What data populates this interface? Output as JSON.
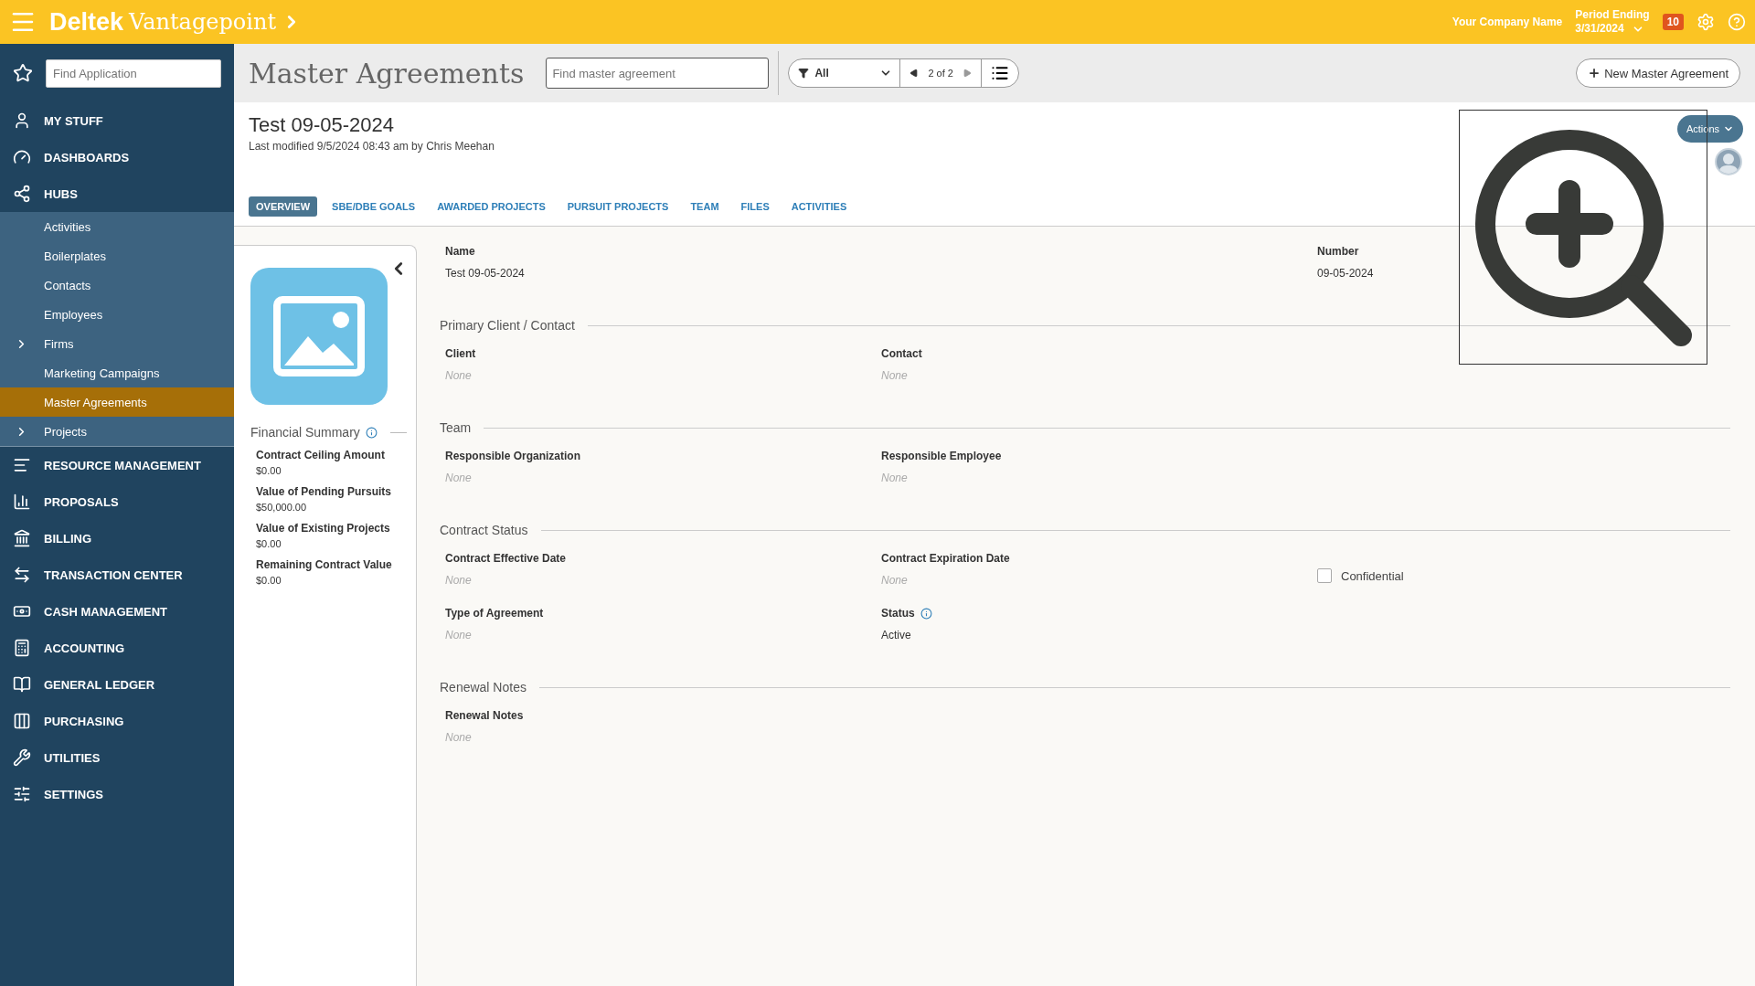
{
  "topbar": {
    "brand_name": "Deltek",
    "brand_product": "Vantagepoint",
    "company": "Your Company Name",
    "period_label": "Period Ending",
    "period_date": "3/31/2024",
    "notifications": "10"
  },
  "sidebar": {
    "search": {
      "placeholder": "Find Application"
    },
    "items": [
      {
        "label": "MY STUFF"
      },
      {
        "label": "DASHBOARDS"
      },
      {
        "label": "HUBS",
        "expanded": true,
        "children": [
          {
            "label": "Activities",
            "selected": false,
            "expandable": false
          },
          {
            "label": "Boilerplates",
            "selected": false,
            "expandable": false
          },
          {
            "label": "Contacts",
            "selected": false,
            "expandable": false
          },
          {
            "label": "Employees",
            "selected": false,
            "expandable": false
          },
          {
            "label": "Firms",
            "selected": false,
            "expandable": true
          },
          {
            "label": "Marketing Campaigns",
            "selected": false,
            "expandable": false
          },
          {
            "label": "Master Agreements",
            "selected": true,
            "expandable": false
          },
          {
            "label": "Projects",
            "selected": false,
            "expandable": true
          }
        ]
      },
      {
        "label": "RESOURCE MANAGEMENT"
      },
      {
        "label": "PROPOSALS"
      },
      {
        "label": "BILLING"
      },
      {
        "label": "TRANSACTION CENTER"
      },
      {
        "label": "CASH MANAGEMENT"
      },
      {
        "label": "ACCOUNTING"
      },
      {
        "label": "GENERAL LEDGER"
      },
      {
        "label": "PURCHASING"
      },
      {
        "label": "UTILITIES"
      },
      {
        "label": "SETTINGS"
      }
    ]
  },
  "toolbar": {
    "title": "Master Agreements",
    "search": {
      "placeholder": "Find master agreement"
    },
    "filter": "All",
    "pager": "2 of 2",
    "new_button": "New Master Agreement"
  },
  "record": {
    "title": "Test 09-05-2024",
    "modified": "Last modified 9/5/2024 08:43 am by Chris Meehan",
    "actions": "Actions",
    "tabs": [
      {
        "label": "OVERVIEW",
        "selected": true
      },
      {
        "label": "SBE/DBE GOALS",
        "selected": false
      },
      {
        "label": "AWARDED PROJECTS",
        "selected": false
      },
      {
        "label": "PURSUIT PROJECTS",
        "selected": false
      },
      {
        "label": "TEAM",
        "selected": false
      },
      {
        "label": "FILES",
        "selected": false
      },
      {
        "label": "ACTIVITIES",
        "selected": false
      }
    ]
  },
  "financial_summary": {
    "title": "Financial Summary",
    "items": [
      {
        "label": "Contract Ceiling Amount",
        "value": "$0.00"
      },
      {
        "label": "Value of Pending Pursuits",
        "value": "$50,000.00"
      },
      {
        "label": "Value of Existing Projects",
        "value": "$0.00"
      },
      {
        "label": "Remaining Contract Value",
        "value": "$0.00"
      }
    ]
  },
  "sections": [
    {
      "rows": [
        [
          {
            "kind": "text",
            "label": "Name",
            "value": "Test 09-05-2024",
            "empty": false,
            "info": false
          },
          {
            "kind": "blank"
          },
          {
            "kind": "text",
            "label": "Number",
            "value": "09-05-2024",
            "empty": false,
            "info": false
          }
        ]
      ]
    },
    {
      "title": "Primary Client / Contact",
      "rows": [
        [
          {
            "kind": "text",
            "label": "Client",
            "value": "None",
            "empty": true,
            "info": false
          },
          {
            "kind": "text",
            "label": "Contact",
            "value": "None",
            "empty": true,
            "info": false
          }
        ]
      ]
    },
    {
      "title": "Team",
      "rows": [
        [
          {
            "kind": "text",
            "label": "Responsible Organization",
            "value": "None",
            "empty": true,
            "info": false
          },
          {
            "kind": "text",
            "label": "Responsible Employee",
            "value": "None",
            "empty": true,
            "info": false
          }
        ]
      ]
    },
    {
      "title": "Contract Status",
      "rows": [
        [
          {
            "kind": "text",
            "label": "Contract Effective Date",
            "value": "None",
            "empty": true,
            "info": false
          },
          {
            "kind": "text",
            "label": "Contract Expiration Date",
            "value": "None",
            "empty": true,
            "info": false
          },
          {
            "kind": "checkbox",
            "label": "Confidential",
            "checked": false
          }
        ],
        [
          {
            "kind": "text",
            "label": "Type of Agreement",
            "value": "None",
            "empty": true,
            "info": false
          },
          {
            "kind": "text",
            "label": "Status",
            "value": "Active",
            "empty": false,
            "info": true
          }
        ]
      ]
    },
    {
      "title": "Renewal Notes",
      "rows": [
        [
          {
            "kind": "text",
            "label": "Renewal Notes",
            "value": "None",
            "empty": true,
            "info": false
          }
        ]
      ]
    }
  ]
}
